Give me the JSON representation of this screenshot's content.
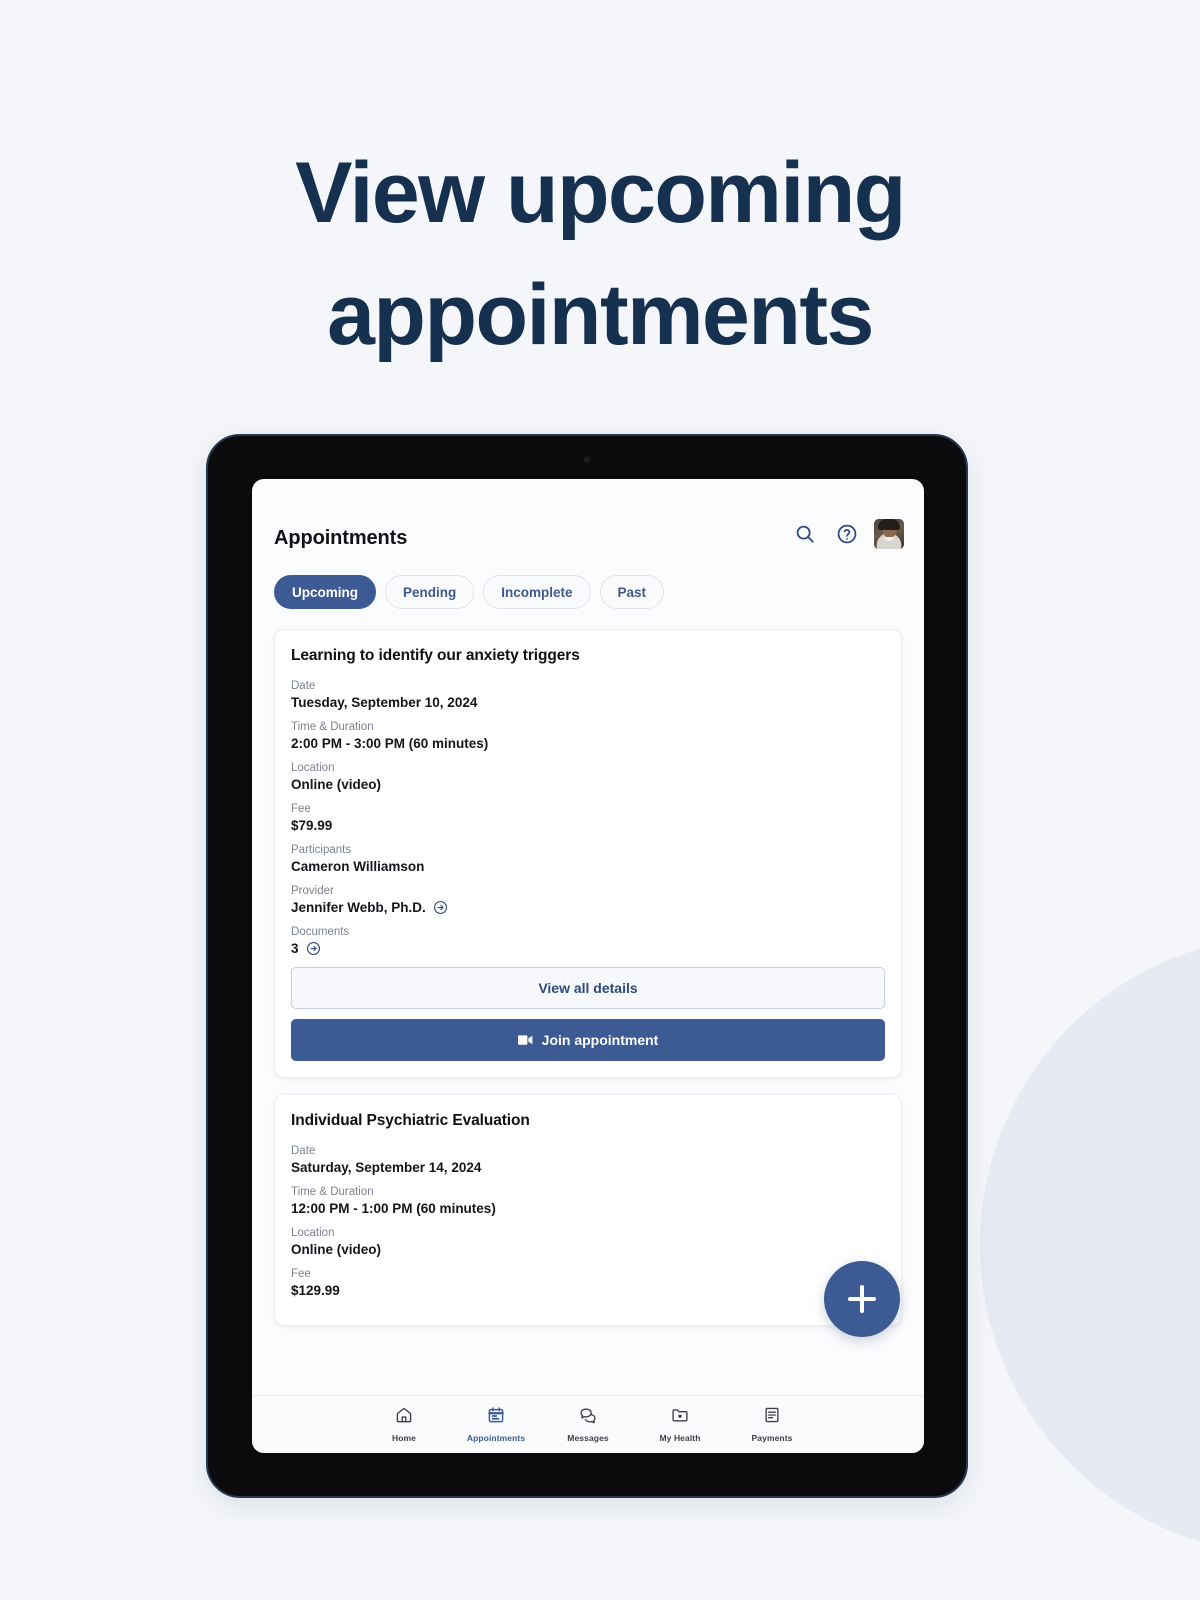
{
  "headline": {
    "line1": "View upcoming",
    "line2": "appointments",
    "color": "#16304f"
  },
  "device": {
    "frame_color": "#0b0b0d",
    "accent_color": "#3c5a94"
  },
  "app": {
    "header": {
      "title": "Appointments",
      "icons": [
        {
          "name": "search-icon",
          "label": "Search"
        },
        {
          "name": "help-icon",
          "label": "Help"
        },
        {
          "name": "avatar",
          "label": "Profile"
        }
      ]
    },
    "tabs": [
      {
        "label": "Upcoming",
        "active": true
      },
      {
        "label": "Pending",
        "active": false
      },
      {
        "label": "Incomplete",
        "active": false
      },
      {
        "label": "Past",
        "active": false
      }
    ],
    "cards": [
      {
        "title": "Learning to identify our anxiety triggers",
        "fields": [
          {
            "label": "Date",
            "value": "Tuesday, September 10, 2024",
            "arrow": false
          },
          {
            "label": "Time & Duration",
            "value": "2:00 PM - 3:00 PM (60 minutes)",
            "arrow": false
          },
          {
            "label": "Location",
            "value": "Online (video)",
            "arrow": false
          },
          {
            "label": "Fee",
            "value": "$79.99",
            "arrow": false
          },
          {
            "label": "Participants",
            "value": "Cameron Williamson",
            "arrow": false
          },
          {
            "label": "Provider",
            "value": "Jennifer Webb, Ph.D.",
            "arrow": true
          },
          {
            "label": "Documents",
            "value": "3",
            "arrow": true
          }
        ],
        "secondary_button": "View all details",
        "primary_button": "Join appointment",
        "primary_button_icon": "video-camera-icon"
      },
      {
        "title": "Individual Psychiatric Evaluation",
        "fields": [
          {
            "label": "Date",
            "value": "Saturday, September 14, 2024",
            "arrow": false
          },
          {
            "label": "Time & Duration",
            "value": "12:00 PM - 1:00 PM (60 minutes)",
            "arrow": false
          },
          {
            "label": "Location",
            "value": "Online (video)",
            "arrow": false
          },
          {
            "label": "Fee",
            "value": "$129.99",
            "arrow": false
          }
        ]
      }
    ],
    "fab": {
      "icon": "plus-icon",
      "label": "Add appointment"
    },
    "bottom_nav": [
      {
        "label": "Home",
        "icon": "home-icon",
        "active": false
      },
      {
        "label": "Appointments",
        "icon": "calendar-icon",
        "active": true
      },
      {
        "label": "Messages",
        "icon": "chat-bubbles-icon",
        "active": false
      },
      {
        "label": "My Health",
        "icon": "folder-heart-icon",
        "active": false
      },
      {
        "label": "Payments",
        "icon": "document-icon",
        "active": false
      }
    ]
  }
}
